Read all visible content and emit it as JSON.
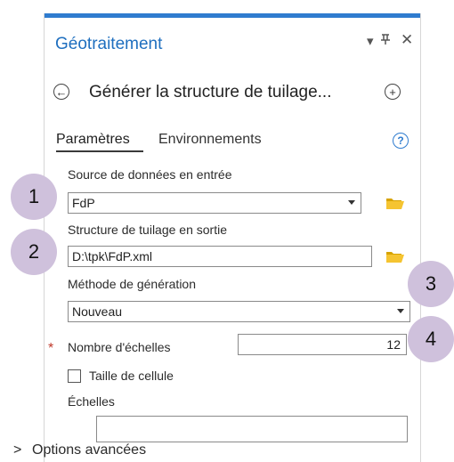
{
  "pane": {
    "title": "Géotraitement",
    "controls": {
      "menu": "▾",
      "pin": "ᵠ",
      "close": "✕"
    }
  },
  "tool": {
    "title": "Générer la structure de tuilage...",
    "back_icon": "←",
    "add_icon": "+"
  },
  "tabs": {
    "parameters": "Paramètres",
    "environments": "Environnements",
    "help": "?"
  },
  "params": {
    "input_label": "Source de données en entrée",
    "input_value": "FdP",
    "output_label": "Structure de tuilage en sortie",
    "output_value": "D:\\tpk\\FdP.xml",
    "method_label": "Méthode de génération",
    "method_value": "Nouveau",
    "scale_count_label": "Nombre d'échelles",
    "scale_count_value": "12",
    "cell_size_label": "Taille de cellule",
    "scales_label": "Échelles",
    "scales_value": ""
  },
  "advanced": {
    "label": "Options avancées",
    "chevron": ">"
  },
  "callouts": [
    "1",
    "2",
    "3",
    "4"
  ],
  "colors": {
    "accent": "#2f7ccf",
    "callout": "#cfc1dc",
    "required": "#c0392b"
  }
}
